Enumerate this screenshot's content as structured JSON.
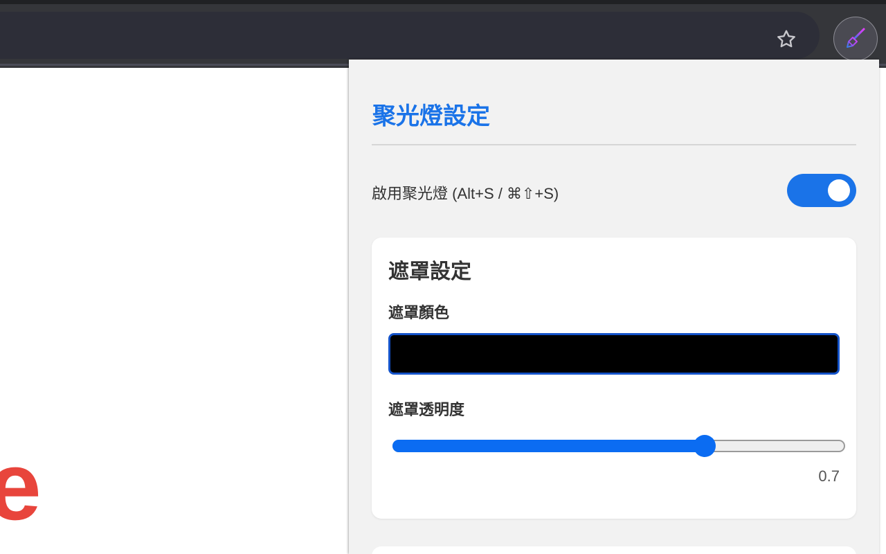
{
  "browser": {
    "star_icon": "star-outline-icon",
    "extension_icon": "paint-brush-icon",
    "extension_icon_colors": [
      "#7b3fe4",
      "#e040fb",
      "#2f80ed"
    ]
  },
  "page": {
    "logo_fragment": "e",
    "logo_color": "#e8453c"
  },
  "popup": {
    "title": "聚光燈設定",
    "enable_label": "啟用聚光燈 (Alt+S / ⌘⇧+S)",
    "enabled": true,
    "accent_color": "#1a73e8",
    "mask_section": {
      "title": "遮罩設定",
      "color_label": "遮罩顏色",
      "color_value": "#000000",
      "opacity_label": "遮罩透明度",
      "opacity_value": "0.7",
      "opacity_fraction": 0.69
    }
  }
}
